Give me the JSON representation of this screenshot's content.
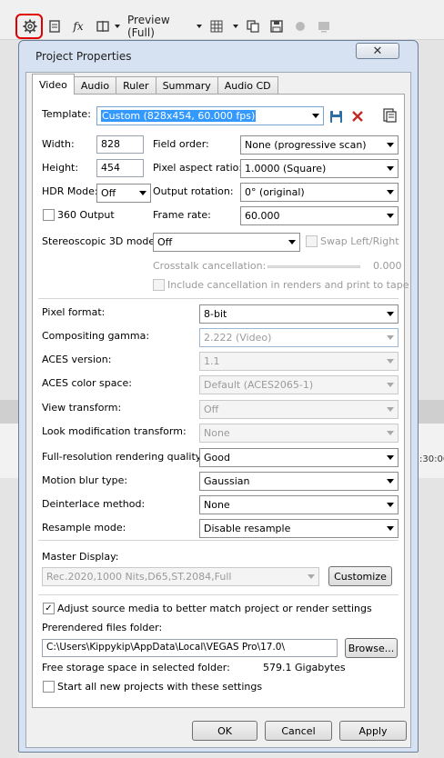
{
  "toolbar": {
    "preview_label": "Preview (Full)",
    "items": [
      "gear-icon",
      "render-icon",
      "fx-icon",
      "split-icon"
    ]
  },
  "timeline": {
    "timecode": ":30:00"
  },
  "dialog": {
    "title": "Project Properties",
    "close_glyph": "✕",
    "tabs": [
      "Video",
      "Audio",
      "Ruler",
      "Summary",
      "Audio CD"
    ],
    "template": {
      "label": "Template:",
      "value": "Custom (828x454, 60.000 fps)"
    },
    "width": {
      "label": "Width:",
      "value": "828"
    },
    "height": {
      "label": "Height:",
      "value": "454"
    },
    "field_order": {
      "label": "Field order:",
      "value": "None (progressive scan)"
    },
    "pixel_aspect": {
      "label": "Pixel aspect ratio:",
      "value": "1.0000 (Square)"
    },
    "hdr_mode": {
      "label": "HDR Mode:",
      "value": "Off"
    },
    "output_rotation": {
      "label": "Output rotation:",
      "value": "0° (original)"
    },
    "output_360": {
      "label": "360 Output",
      "checked": false
    },
    "frame_rate": {
      "label": "Frame rate:",
      "value": "60.000"
    },
    "stereo_mode": {
      "label": "Stereoscopic 3D mode:",
      "value": "Off"
    },
    "swap": {
      "label": "Swap Left/Right",
      "checked": false
    },
    "crosstalk": {
      "label": "Crosstalk cancellation:",
      "value": "0.000"
    },
    "include_cancel": {
      "label": "Include cancellation in renders and print to tape",
      "checked": false
    },
    "pixel_format": {
      "label": "Pixel format:",
      "value": "8-bit"
    },
    "gamma": {
      "label": "Compositing gamma:",
      "value": "2.222 (Video)"
    },
    "aces_version": {
      "label": "ACES version:",
      "value": "1.1"
    },
    "aces_space": {
      "label": "ACES color space:",
      "value": "Default (ACES2065-1)"
    },
    "view_transform": {
      "label": "View transform:",
      "value": "Off"
    },
    "look_mod": {
      "label": "Look modification transform:",
      "value": "None"
    },
    "render_quality": {
      "label": "Full-resolution rendering quality:",
      "value": "Good"
    },
    "motion_blur": {
      "label": "Motion blur type:",
      "value": "Gaussian"
    },
    "deinterlace": {
      "label": "Deinterlace method:",
      "value": "None"
    },
    "resample": {
      "label": "Resample mode:",
      "value": "Disable resample"
    },
    "master_display": {
      "label": "Master Display:",
      "value": "Rec.2020,1000 Nits,D65,ST.2084,Full",
      "customize": "Customize"
    },
    "adjust_source": {
      "label": "Adjust source media to better match project or render settings",
      "checked": true
    },
    "prerender": {
      "label": "Prerendered files folder:",
      "value": "C:\\Users\\Kippykip\\AppData\\Local\\VEGAS Pro\\17.0\\",
      "browse": "Browse..."
    },
    "free_space": {
      "label": "Free storage space in selected folder:",
      "value": "579.1 Gigabytes"
    },
    "start_all": {
      "label": "Start all new projects with these settings",
      "checked": false
    },
    "buttons": {
      "ok": "OK",
      "cancel": "Cancel",
      "apply": "Apply"
    },
    "check_glyph": "✓"
  }
}
